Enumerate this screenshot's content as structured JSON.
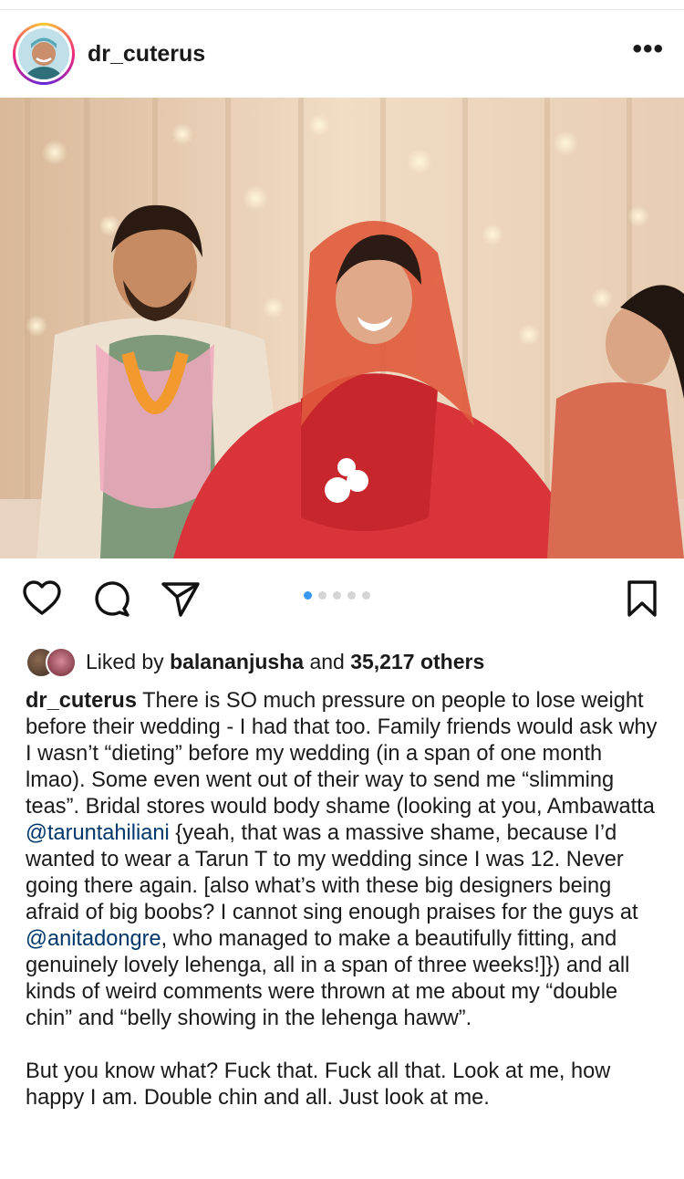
{
  "post": {
    "username": "dr_cuterus",
    "more_icon": "more-horizontal-icon"
  },
  "carousel": {
    "total": 5,
    "active_index": 0,
    "active_color": "#3897f0"
  },
  "actions": {
    "like_icon": "heart-icon",
    "comment_icon": "comment-icon",
    "share_icon": "send-icon",
    "save_icon": "bookmark-icon"
  },
  "likes": {
    "prefix": "Liked by",
    "liker": "balananjusha",
    "joiner": "and",
    "others": "35,217 others"
  },
  "caption": {
    "username": "dr_cuterus",
    "part1": " There is SO much pressure on people to lose weight before their wedding - I had that too. Family friends would ask why I wasn’t “dieting” before my wedding (in a span of one month lmao). Some even went out of their way to send me “slimming teas”. Bridal stores would body shame (looking at you, Ambawatta ",
    "mention1": "@taruntahiliani",
    "part2": " {yeah, that was a massive shame, because I’d wanted to wear a Tarun T to my wedding since I was 12. Never going there again. [also what’s with these big designers being afraid of big boobs? I cannot sing enough praises for the guys at ",
    "mention2": "@anitadongre",
    "part3": ", who managed to make a beautifully fitting, and genuinely lovely lehenga, all in a span of three weeks!]}) and all kinds of weird comments were thrown at me about my “double chin” and “belly showing in the lehenga haww”.",
    "paragraph2": "But you know what? Fuck that. Fuck all that. Look at me, how happy I am. Double chin and all. Just look at me."
  },
  "colors": {
    "mention": "#00376b",
    "text": "#1a1a1a"
  }
}
